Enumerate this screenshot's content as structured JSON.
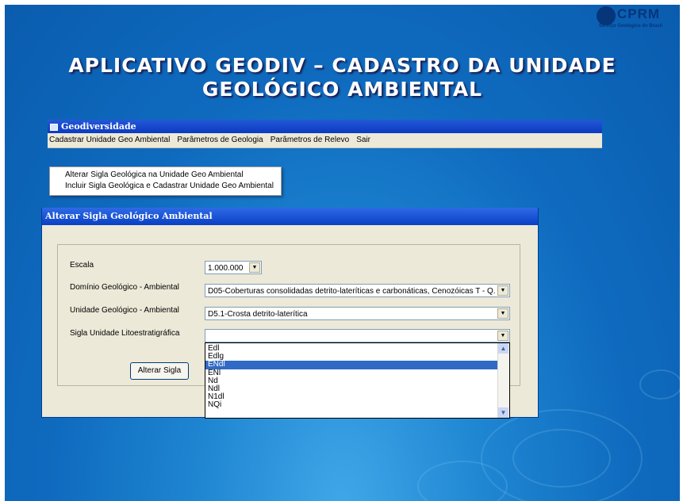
{
  "slide": {
    "title_line1": "APLICATIVO GEODIV – CADASTRO DA UNIDADE",
    "title_line2": "GEOLÓGICO AMBIENTAL",
    "logo_text": "CPRM",
    "logo_subtitle": "Serviço Geológico do Brasil"
  },
  "app": {
    "title": "Geodiversidade",
    "menu": [
      "Cadastrar Unidade Geo Ambiental",
      "Parâmetros de Geologia",
      "Parâmetros de Relevo",
      "Sair"
    ]
  },
  "submenu": {
    "items": [
      "Alterar Sigla Geológica na Unidade Geo Ambiental",
      "Incluir Sigla Geológica e Cadastrar Unidade Geo Ambiental"
    ]
  },
  "dialog": {
    "title": "Alterar Sigla Geológico Ambiental",
    "escala_label": "Escala",
    "escala_value": "1.000.000",
    "dominio_label": "Domínio Geológico - Ambiental",
    "dominio_value": "D05-Coberturas consolidadas detrito-lateríticas e carbonáticas, Cenozóicas T - Q.",
    "unidade_label": "Unidade Geológico - Ambiental",
    "unidade_value": "D5.1-Crosta detrito-laterítica",
    "sigla_label": "Sigla Unidade Litoestratigráfica",
    "sigla_value": "",
    "alterar_button": "Alterar Sigla",
    "dropdown_items": [
      "Edl",
      "Edlg",
      "ENdl",
      "ENl",
      "Nd",
      "Ndl",
      "N1dl",
      "NQi"
    ],
    "dropdown_selected": "ENdl"
  },
  "colors": {
    "slide_bg": "#0f6bbf",
    "titlebar": "#0b3bc0",
    "selection": "#316ac5"
  }
}
